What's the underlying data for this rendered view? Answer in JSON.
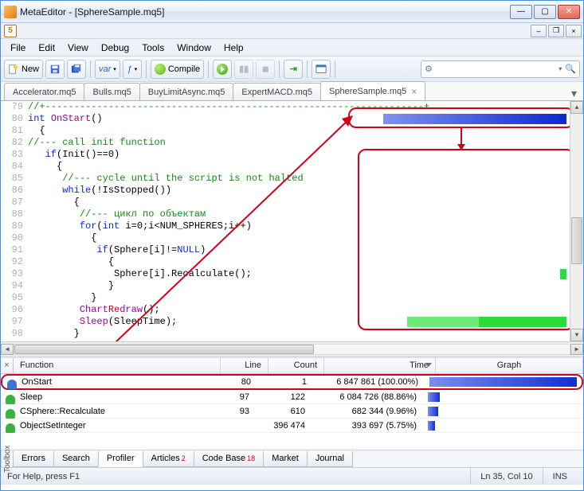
{
  "window": {
    "title": "MetaEditor - [SphereSample.mq5]"
  },
  "menubar": [
    "File",
    "Edit",
    "View",
    "Debug",
    "Tools",
    "Window",
    "Help"
  ],
  "toolbar": {
    "new_label": "New",
    "compile_label": "Compile"
  },
  "filetabs": {
    "items": [
      {
        "label": "Accelerator.mq5",
        "active": false
      },
      {
        "label": "Bulls.mq5",
        "active": false
      },
      {
        "label": "BuyLimitAsync.mq5",
        "active": false
      },
      {
        "label": "ExpertMACD.mq5",
        "active": false
      },
      {
        "label": "SphereSample.mq5",
        "active": true
      }
    ]
  },
  "code": {
    "lines": [
      {
        "n": 79,
        "html": "<span class='kw-comm'>//+------------------------------------------------------------------+</span>"
      },
      {
        "n": 80,
        "html": "<span class='kw-type'>int</span> <span class='kw-func'>OnStart</span>()"
      },
      {
        "n": 81,
        "html": "  {"
      },
      {
        "n": 82,
        "html": "<span class='kw-comm'>//--- call init function</span>"
      },
      {
        "n": 83,
        "html": "   <span class='kw-type'>if</span>(<span class='kw-id'>Init</span>()==0)"
      },
      {
        "n": 84,
        "html": "     {"
      },
      {
        "n": 85,
        "html": "      <span class='kw-comm'>//--- cycle until the script is not halted</span>"
      },
      {
        "n": 86,
        "html": "      <span class='kw-type'>while</span>(!<span class='kw-id'>IsStopped</span>())"
      },
      {
        "n": 87,
        "html": "        {"
      },
      {
        "n": 88,
        "html": "         <span class='kw-comm'>//--- цикл по объектам</span>"
      },
      {
        "n": 89,
        "html": "         <span class='kw-type'>for</span>(<span class='kw-type'>int</span> i=0;i&lt;NUM_SPHERES;i++)"
      },
      {
        "n": 90,
        "html": "           {"
      },
      {
        "n": 91,
        "html": "            <span class='kw-type'>if</span>(Sphere[i]!=<span class='kw-type'>NULL</span>)"
      },
      {
        "n": 92,
        "html": "              {"
      },
      {
        "n": 93,
        "html": "               Sphere[i].<span class='kw-id'>Recalculate</span>();"
      },
      {
        "n": 94,
        "html": "              }"
      },
      {
        "n": 95,
        "html": "           }"
      },
      {
        "n": 96,
        "html": "         <span class='kw-func'>Chart<span style='color:#d30018'>Re</span>draw</span>();"
      },
      {
        "n": 97,
        "html": "         <span class='kw-func'>Sleep</span>(SleepTime);"
      },
      {
        "n": 98,
        "html": "        }"
      }
    ]
  },
  "toolbox": {
    "columns": {
      "func": "Function",
      "line": "Line",
      "count": "Count",
      "time": "Time",
      "graph": "Graph"
    },
    "rows": [
      {
        "icon": "#3d74d6",
        "func": "OnStart",
        "line": "80",
        "count": "1",
        "time": "6 847 861 (100.00%)",
        "pct": 100
      },
      {
        "icon": "#3ab23d",
        "func": "Sleep",
        "line": "97",
        "count": "122",
        "time": "6 084 726 (88.86%)",
        "pct": 8
      },
      {
        "icon": "#3ab23d",
        "func": "CSphere::Recalculate",
        "line": "93",
        "count": "610",
        "time": "682 344  (9.96%)",
        "pct": 7
      },
      {
        "icon": "#3ab23d",
        "func": "ObjectSetInteger",
        "line": "",
        "count": "396 474",
        "time": "393 697  (5.75%)",
        "pct": 5
      }
    ]
  },
  "bottomtabs": {
    "side": "Toolbox",
    "items": [
      {
        "label": "Errors"
      },
      {
        "label": "Search"
      },
      {
        "label": "Profiler",
        "active": true
      },
      {
        "label": "Articles",
        "badge": "2"
      },
      {
        "label": "Code Base",
        "badge": "18"
      },
      {
        "label": "Market"
      },
      {
        "label": "Journal"
      }
    ]
  },
  "statusbar": {
    "help": "For Help, press F1",
    "pos": "Ln 35, Col 10",
    "mode": "INS"
  }
}
